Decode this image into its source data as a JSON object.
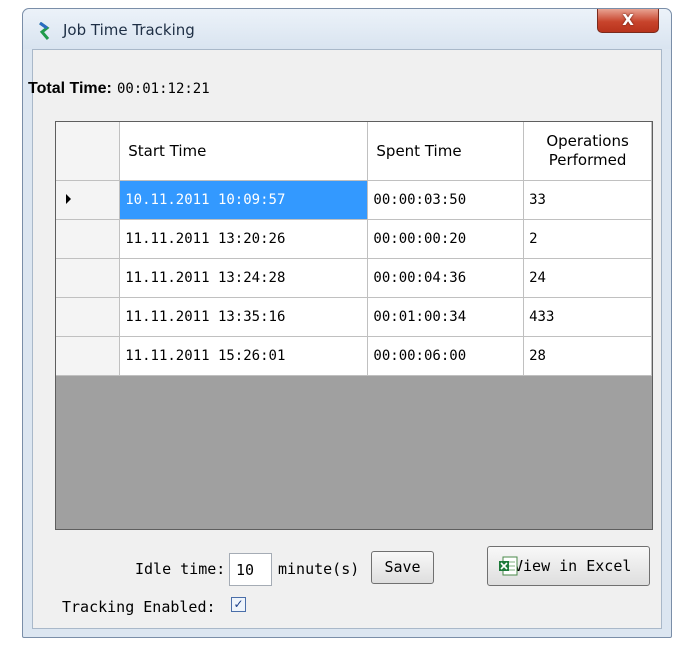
{
  "window": {
    "title": "Job Time Tracking",
    "close_label": "X"
  },
  "total": {
    "label": "Total Time:",
    "value": "00:01:12:21"
  },
  "grid": {
    "columns": [
      "Start Time",
      "Spent Time"
    ],
    "ops_header": [
      "Operations",
      "Performed"
    ],
    "rows": [
      {
        "start": "10.11.2011 10:09:57",
        "spent": "00:00:03:50",
        "ops": "33"
      },
      {
        "start": "11.11.2011 13:20:26",
        "spent": "00:00:00:20",
        "ops": "2"
      },
      {
        "start": "11.11.2011 13:24:28",
        "spent": "00:00:04:36",
        "ops": "24"
      },
      {
        "start": "11.11.2011 13:35:16",
        "spent": "00:01:00:34",
        "ops": "433"
      },
      {
        "start": "11.11.2011 15:26:01",
        "spent": "00:00:06:00",
        "ops": "28"
      }
    ]
  },
  "settings": {
    "idle_label": "Idle time:",
    "idle_value": "10",
    "unit_label": "minute(s)",
    "save_label": "Save",
    "excel_label": "View in Excel",
    "tracking_label": "Tracking Enabled:",
    "tracking_checked": "✓"
  },
  "colors": {
    "selection": "#3399ff",
    "grid_background": "#a0a0a0",
    "close_button": "#c8442c"
  },
  "icons": {
    "app": "app-logo-icon",
    "excel": "excel-icon",
    "row_indicator": "current-row-arrow-icon"
  }
}
